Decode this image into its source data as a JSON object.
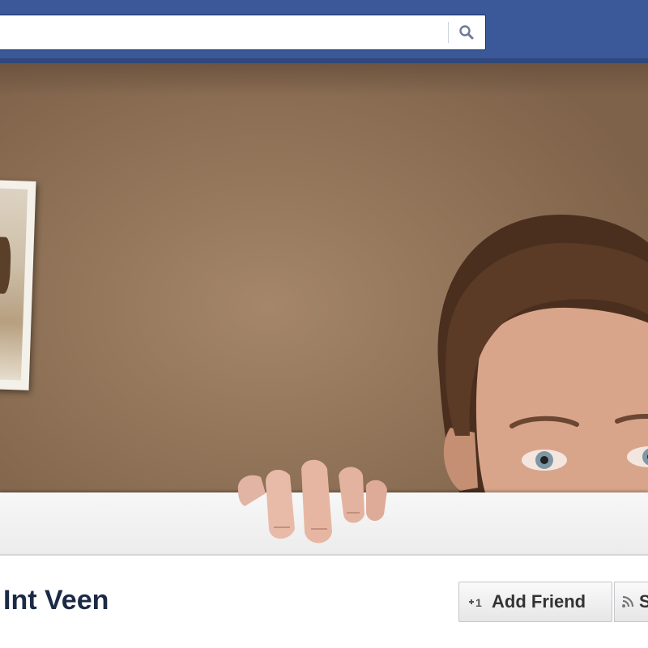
{
  "header": {
    "search": {
      "placeholder": "",
      "value": ""
    },
    "search_icon": "search-icon",
    "bar_color": "#3b5998"
  },
  "cover": {
    "background_color": "#8f7257"
  },
  "profile": {
    "name": "Int Veen",
    "add_friend_label": "Add Friend",
    "subscribe_label": "S",
    "add_friend_icon": "add-friend-icon",
    "subscribe_icon": "rss-icon"
  }
}
